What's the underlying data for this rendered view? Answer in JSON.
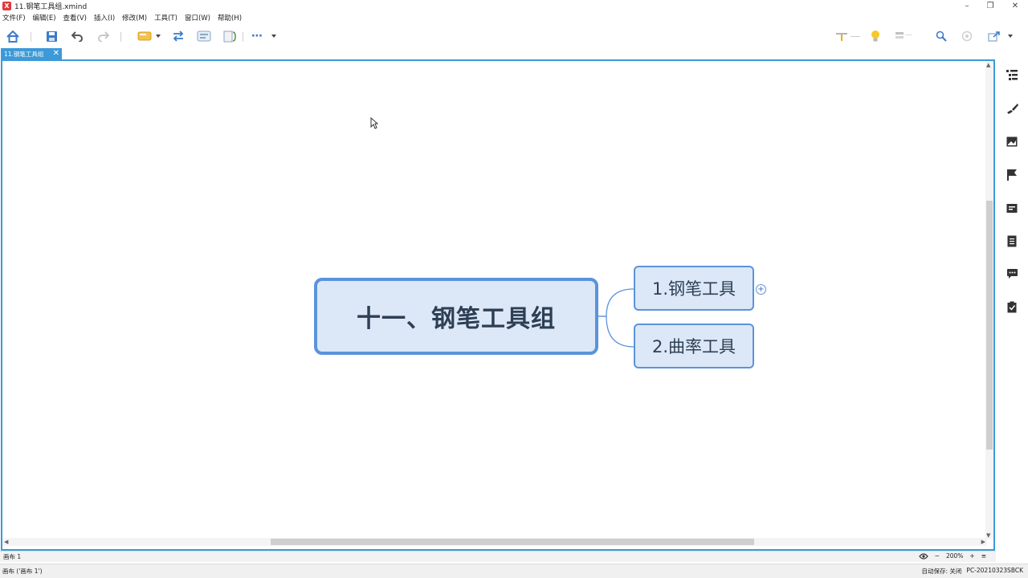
{
  "window": {
    "title": "11.钢笔工具组.xmind",
    "min_glyph": "–",
    "max_glyph": "❐",
    "close_glyph": "✕"
  },
  "menu": [
    "文件(F)",
    "编辑(E)",
    "查看(V)",
    "插入(I)",
    "修改(M)",
    "工具(T)",
    "窗口(W)",
    "帮助(H)"
  ],
  "toolbar": {
    "more_label": "⋯"
  },
  "tab": {
    "label": "11.钢笔工具组",
    "close_glyph": "✕"
  },
  "mindmap": {
    "central": "十一、钢笔工具组",
    "subtopics": [
      "1.钢笔工具",
      "2.曲率工具"
    ],
    "expand_glyph": "+"
  },
  "sheet": {
    "label": "画布 1",
    "zoom": "200%",
    "minus": "−",
    "plus": "+"
  },
  "status": {
    "left": "画布 ('画布 1')",
    "autosave": "自动保存: 关闭",
    "machine": "PC-20210323SBCK"
  },
  "colors": {
    "accent": "#3c9ad8",
    "topic_border": "#5b93db",
    "topic_fill": "#dce8f7",
    "topic_text": "#2e3f55"
  }
}
